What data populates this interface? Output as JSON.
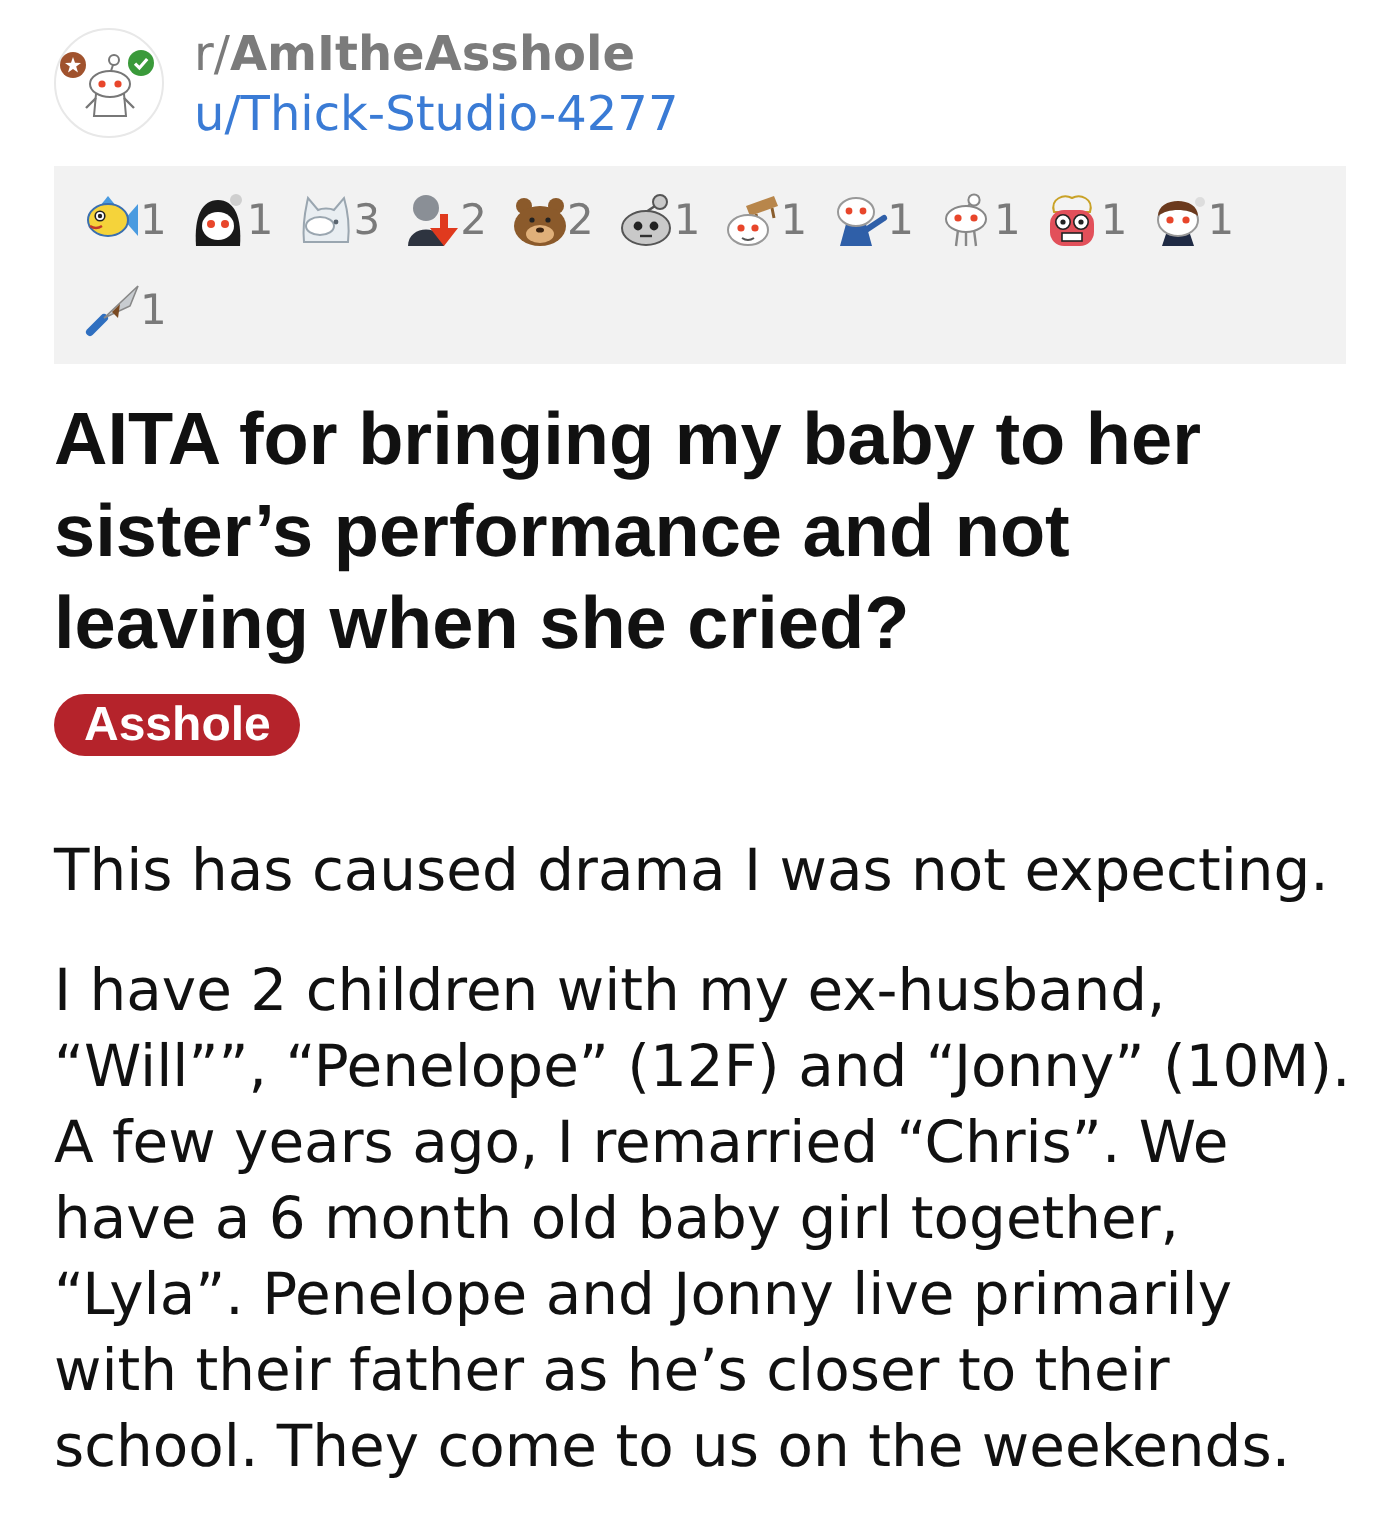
{
  "header": {
    "subreddit": "r/**AmItheAsshole**",
    "username": "u/Thick-Studio-4277"
  },
  "awards": [
    {
      "kind": "fish",
      "count": "1"
    },
    {
      "kind": "long-hair-mascot",
      "count": "1"
    },
    {
      "kind": "cat",
      "count": "3"
    },
    {
      "kind": "down-arrow-figure",
      "count": "2"
    },
    {
      "kind": "bear",
      "count": "2"
    },
    {
      "kind": "robot-head",
      "count": "1"
    },
    {
      "kind": "table-mascot",
      "count": "1"
    },
    {
      "kind": "pointing-mascot",
      "count": "1"
    },
    {
      "kind": "mascot",
      "count": "1"
    },
    {
      "kind": "exploding-head",
      "count": "1"
    },
    {
      "kind": "short-hair-mascot",
      "count": "1"
    },
    {
      "kind": "knife",
      "count": "1"
    }
  ],
  "post": {
    "title": "AITA for bringing my baby to her sister’s performance and not leaving when she cried?",
    "flair": "Asshole"
  },
  "body": [
    "This has caused drama I was not expecting.",
    "I have 2 children with my ex-husband, “Will””, “Penelope” (12F) and “Jonny” (10M). A few years ago, I remarried “Chris”. We have a 6 month old baby girl together, “Lyla”. Penelope and Jonny live primarily with their father as he’s closer to their school. They come to us on the weekends."
  ]
}
